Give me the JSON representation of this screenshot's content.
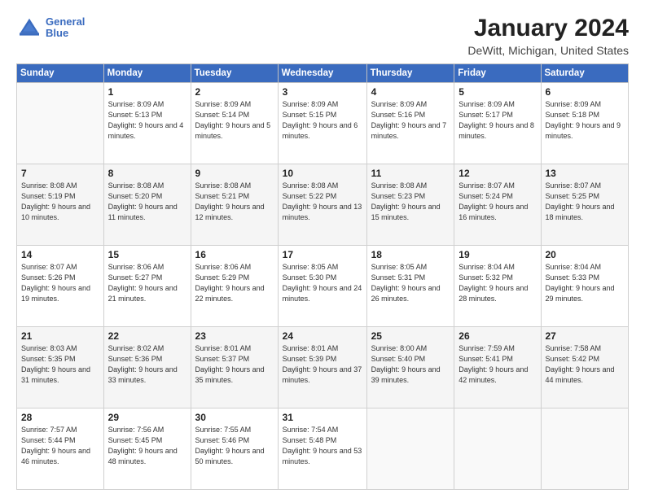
{
  "logo": {
    "text_general": "General",
    "text_blue": "Blue"
  },
  "header": {
    "month": "January 2024",
    "location": "DeWitt, Michigan, United States"
  },
  "weekdays": [
    "Sunday",
    "Monday",
    "Tuesday",
    "Wednesday",
    "Thursday",
    "Friday",
    "Saturday"
  ],
  "weeks": [
    [
      {
        "day": "",
        "empty": true
      },
      {
        "day": "1",
        "sunrise": "8:09 AM",
        "sunset": "5:13 PM",
        "daylight": "9 hours and 4 minutes."
      },
      {
        "day": "2",
        "sunrise": "8:09 AM",
        "sunset": "5:14 PM",
        "daylight": "9 hours and 5 minutes."
      },
      {
        "day": "3",
        "sunrise": "8:09 AM",
        "sunset": "5:15 PM",
        "daylight": "9 hours and 6 minutes."
      },
      {
        "day": "4",
        "sunrise": "8:09 AM",
        "sunset": "5:16 PM",
        "daylight": "9 hours and 7 minutes."
      },
      {
        "day": "5",
        "sunrise": "8:09 AM",
        "sunset": "5:17 PM",
        "daylight": "9 hours and 8 minutes."
      },
      {
        "day": "6",
        "sunrise": "8:09 AM",
        "sunset": "5:18 PM",
        "daylight": "9 hours and 9 minutes."
      }
    ],
    [
      {
        "day": "7",
        "sunrise": "8:08 AM",
        "sunset": "5:19 PM",
        "daylight": "9 hours and 10 minutes."
      },
      {
        "day": "8",
        "sunrise": "8:08 AM",
        "sunset": "5:20 PM",
        "daylight": "9 hours and 11 minutes."
      },
      {
        "day": "9",
        "sunrise": "8:08 AM",
        "sunset": "5:21 PM",
        "daylight": "9 hours and 12 minutes."
      },
      {
        "day": "10",
        "sunrise": "8:08 AM",
        "sunset": "5:22 PM",
        "daylight": "9 hours and 13 minutes."
      },
      {
        "day": "11",
        "sunrise": "8:08 AM",
        "sunset": "5:23 PM",
        "daylight": "9 hours and 15 minutes."
      },
      {
        "day": "12",
        "sunrise": "8:07 AM",
        "sunset": "5:24 PM",
        "daylight": "9 hours and 16 minutes."
      },
      {
        "day": "13",
        "sunrise": "8:07 AM",
        "sunset": "5:25 PM",
        "daylight": "9 hours and 18 minutes."
      }
    ],
    [
      {
        "day": "14",
        "sunrise": "8:07 AM",
        "sunset": "5:26 PM",
        "daylight": "9 hours and 19 minutes."
      },
      {
        "day": "15",
        "sunrise": "8:06 AM",
        "sunset": "5:27 PM",
        "daylight": "9 hours and 21 minutes."
      },
      {
        "day": "16",
        "sunrise": "8:06 AM",
        "sunset": "5:29 PM",
        "daylight": "9 hours and 22 minutes."
      },
      {
        "day": "17",
        "sunrise": "8:05 AM",
        "sunset": "5:30 PM",
        "daylight": "9 hours and 24 minutes."
      },
      {
        "day": "18",
        "sunrise": "8:05 AM",
        "sunset": "5:31 PM",
        "daylight": "9 hours and 26 minutes."
      },
      {
        "day": "19",
        "sunrise": "8:04 AM",
        "sunset": "5:32 PM",
        "daylight": "9 hours and 28 minutes."
      },
      {
        "day": "20",
        "sunrise": "8:04 AM",
        "sunset": "5:33 PM",
        "daylight": "9 hours and 29 minutes."
      }
    ],
    [
      {
        "day": "21",
        "sunrise": "8:03 AM",
        "sunset": "5:35 PM",
        "daylight": "9 hours and 31 minutes."
      },
      {
        "day": "22",
        "sunrise": "8:02 AM",
        "sunset": "5:36 PM",
        "daylight": "9 hours and 33 minutes."
      },
      {
        "day": "23",
        "sunrise": "8:01 AM",
        "sunset": "5:37 PM",
        "daylight": "9 hours and 35 minutes."
      },
      {
        "day": "24",
        "sunrise": "8:01 AM",
        "sunset": "5:39 PM",
        "daylight": "9 hours and 37 minutes."
      },
      {
        "day": "25",
        "sunrise": "8:00 AM",
        "sunset": "5:40 PM",
        "daylight": "9 hours and 39 minutes."
      },
      {
        "day": "26",
        "sunrise": "7:59 AM",
        "sunset": "5:41 PM",
        "daylight": "9 hours and 42 minutes."
      },
      {
        "day": "27",
        "sunrise": "7:58 AM",
        "sunset": "5:42 PM",
        "daylight": "9 hours and 44 minutes."
      }
    ],
    [
      {
        "day": "28",
        "sunrise": "7:57 AM",
        "sunset": "5:44 PM",
        "daylight": "9 hours and 46 minutes."
      },
      {
        "day": "29",
        "sunrise": "7:56 AM",
        "sunset": "5:45 PM",
        "daylight": "9 hours and 48 minutes."
      },
      {
        "day": "30",
        "sunrise": "7:55 AM",
        "sunset": "5:46 PM",
        "daylight": "9 hours and 50 minutes."
      },
      {
        "day": "31",
        "sunrise": "7:54 AM",
        "sunset": "5:48 PM",
        "daylight": "9 hours and 53 minutes."
      },
      {
        "day": "",
        "empty": true
      },
      {
        "day": "",
        "empty": true
      },
      {
        "day": "",
        "empty": true
      }
    ]
  ]
}
